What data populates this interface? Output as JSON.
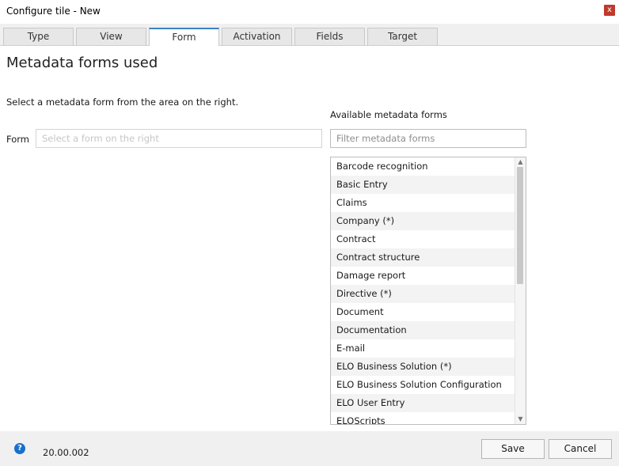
{
  "window": {
    "title": "Configure tile - New",
    "close_glyph": "x"
  },
  "tabs": [
    {
      "label": "Type"
    },
    {
      "label": "View"
    },
    {
      "label": "Form"
    },
    {
      "label": "Activation"
    },
    {
      "label": "Fields"
    },
    {
      "label": "Target"
    }
  ],
  "active_tab": "Form",
  "main": {
    "heading": "Metadata forms used",
    "hint": "Select a metadata form from the area on the right.",
    "form_label": "Form",
    "form_placeholder": "Select a form on the right",
    "available_label": "Available metadata forms",
    "filter_placeholder": "Filter metadata forms",
    "items": [
      "Barcode recognition",
      "Basic Entry",
      "Claims",
      "Company (*)",
      "Contract",
      "Contract structure",
      "Damage report",
      "Directive (*)",
      "Document",
      "Documentation",
      "E-mail",
      "ELO Business Solution (*)",
      "ELO Business Solution Configuration",
      "ELO User Entry",
      "ELOScripts"
    ]
  },
  "footer": {
    "help_glyph": "?",
    "version": "20.00.002",
    "save_label": "Save",
    "cancel_label": "Cancel"
  },
  "colors": {
    "accent": "#3b82c4",
    "close": "#c0392b",
    "help": "#1a6fc9"
  }
}
